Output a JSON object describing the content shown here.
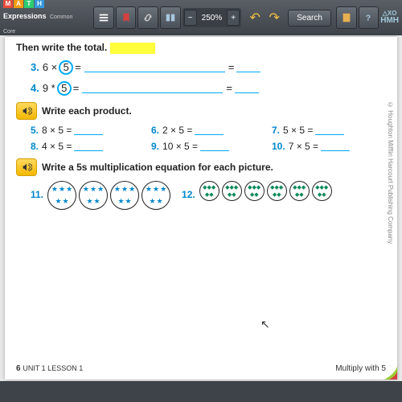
{
  "toolbar": {
    "brand_letters": [
      "M",
      "A",
      "T",
      "H"
    ],
    "brand_text": "Expressions",
    "brand_sub": "Common Core",
    "zoom": "250%",
    "search": "Search",
    "hmh_top": "△XO",
    "hmh": "HMH"
  },
  "page": {
    "instr1": "Then write the total.",
    "p3_num": "3.",
    "p3_expr_a": "6 ×",
    "p3_expr_b": "5",
    "p3_eq": "=",
    "p4_num": "4.",
    "p4_expr_a": "9 *",
    "p4_expr_b": "5",
    "p4_eq": "=",
    "sec2": "Write each product.",
    "p5_num": "5.",
    "p5": "8 × 5 =",
    "p6_num": "6.",
    "p6": "2 × 5 =",
    "p7_num": "7.",
    "p7": "5 × 5 =",
    "p8_num": "8.",
    "p8": "4 × 5 =",
    "p9_num": "9.",
    "p9": "10 × 5 =",
    "p10_num": "10.",
    "p10": "7 × 5 =",
    "sec3": "Write a 5s multiplication equation for each picture.",
    "p11_num": "11.",
    "p12_num": "12.",
    "copyright": "© Houghton Mifflin Harcourt Publishing Company",
    "footer_page": "6",
    "footer_unit": "UNIT 1 LESSON 1",
    "footer_right": "Multiply with 5"
  }
}
